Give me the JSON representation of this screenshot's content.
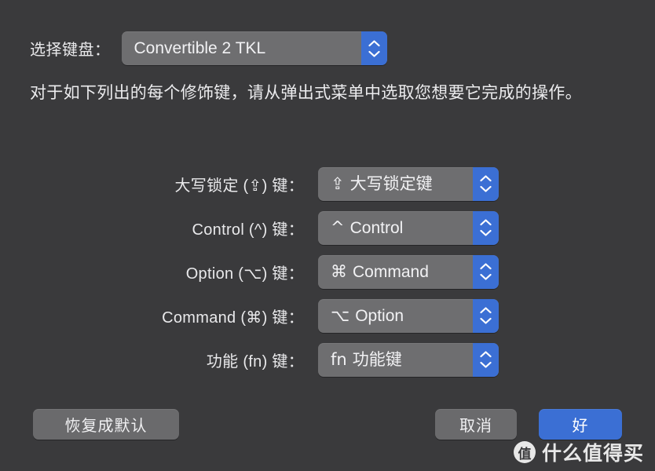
{
  "window": {
    "background_color": "#3a3a3c",
    "accent_color": "#3b6fd4"
  },
  "keyboard_selector": {
    "label": "选择键盘：",
    "value": "Convertible 2 TKL"
  },
  "description": "对于如下列出的每个修饰键，请从弹出式菜单中选取您想要它完成的操作。",
  "modifiers": [
    {
      "label": "大写锁定 (⇪) 键：",
      "symbol": "⇪",
      "value": "大写锁定键"
    },
    {
      "label": "Control (^) 键：",
      "symbol": "^",
      "value": "Control"
    },
    {
      "label": "Option (⌥) 键：",
      "symbol": "⌘",
      "value": "Command"
    },
    {
      "label": "Command (⌘) 键：",
      "symbol": "⌥",
      "value": "Option"
    },
    {
      "label": "功能 (fn) 键：",
      "symbol": "fn",
      "value": "功能键"
    }
  ],
  "buttons": {
    "reset": "恢复成默认",
    "cancel": "取消",
    "ok": "好"
  },
  "watermark": {
    "badge": "值",
    "text": "什么值得买"
  }
}
